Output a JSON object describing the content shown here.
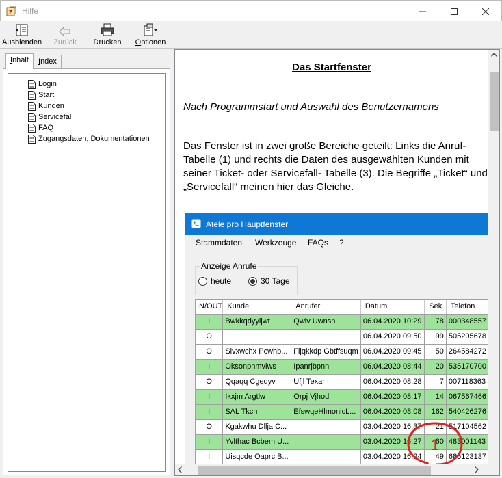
{
  "window": {
    "title": "Hilfe"
  },
  "toolbar": {
    "hide_label": "Ausblenden",
    "back_label": "Zurück",
    "print_label": "Drucken",
    "options_label": "Optionen"
  },
  "tabs": [
    {
      "pre": "",
      "u": "I",
      "post": "nhalt"
    },
    {
      "pre": "",
      "u": "I",
      "post": "ndex"
    }
  ],
  "tree": [
    "Login",
    "Start",
    "Kunden",
    "Servicefall",
    "FAQ",
    "Zugangsdaten, Dokumentationen"
  ],
  "doc": {
    "title": "Das Startfenster",
    "subtitle": "Nach Programmstart und Auswahl des Benutzernamens",
    "paragraph": "Das Fenster ist in zwei große Bereiche geteilt: Links die Anruf-Tabelle (1) und rechts die Daten des ausgewählten Kunden mit seiner Ticket- oder Servicefall- Tabelle (3). Die Begriffe „Ticket“ und „Servicefall“ meinen hier das Gleiche."
  },
  "embedded_app": {
    "title": "Atele pro Hauptfenster",
    "menu": [
      "Stammdaten",
      "Werkzeuge",
      "FAQs",
      "?"
    ],
    "group_title": "Anzeige Anrufe",
    "radio_today": "heute",
    "radio_30": "30 Tage",
    "annotation_number": "1",
    "columns": [
      "IN/OUT",
      "Kunde",
      "Anrufer",
      "Datum",
      "Sek.",
      "Telefon"
    ],
    "rows": [
      {
        "io": "I",
        "kunde": "Bwkkqdyyljwt",
        "anrufer": "Qwiv Uwnsn",
        "datum": "06.04.2020 10:29",
        "sek": "78",
        "tel": "000348557",
        "incoming": true
      },
      {
        "io": "O",
        "kunde": "",
        "anrufer": "",
        "datum": "06.04.2020 09:50",
        "sek": "99",
        "tel": "505205678",
        "incoming": false
      },
      {
        "io": "O",
        "kunde": "Sivxwchx Pcwhb...",
        "anrufer": "Fijqkkdp Gbtffsuqm",
        "datum": "06.04.2020 09:45",
        "sek": "50",
        "tel": "264584272",
        "incoming": false
      },
      {
        "io": "I",
        "kunde": "Oksonpnmviws",
        "anrufer": "Ipanrjbpnn",
        "datum": "06.04.2020 08:44",
        "sek": "20",
        "tel": "535170700",
        "incoming": true
      },
      {
        "io": "O",
        "kunde": "Qqaqq Cgeqyv",
        "anrufer": "Ufjl Texar",
        "datum": "06.04.2020 08:28",
        "sek": "7",
        "tel": "007118363",
        "incoming": false
      },
      {
        "io": "I",
        "kunde": "Ikxjm Argtlw",
        "anrufer": "Orpj Vjhod",
        "datum": "06.04.2020 08:17",
        "sek": "14",
        "tel": "067567466",
        "incoming": true
      },
      {
        "io": "I",
        "kunde": "SAL Tkch",
        "anrufer": "EfswqeHlmonicL...",
        "datum": "06.04.2020 08:08",
        "sek": "162",
        "tel": "540426276",
        "incoming": true
      },
      {
        "io": "O",
        "kunde": "Kgakwhu Dllja C...",
        "anrufer": "",
        "datum": "03.04.2020 16:37",
        "sek": "21",
        "tel": "517104562",
        "incoming": false
      },
      {
        "io": "I",
        "kunde": "Yvlthac Bcbem U...",
        "anrufer": "",
        "datum": "03.04.2020 16:27",
        "sek": "60",
        "tel": "483001143",
        "incoming": true
      },
      {
        "io": "I",
        "kunde": "Uisqcde Oaprc B...",
        "anrufer": "",
        "datum": "03.04.2020 16:24",
        "sek": "49",
        "tel": "685123137",
        "incoming": false
      }
    ]
  },
  "colors": {
    "incoming_row": "#9de39a",
    "app_titlebar": "#0e78d7",
    "annotation": "#e0201c"
  }
}
